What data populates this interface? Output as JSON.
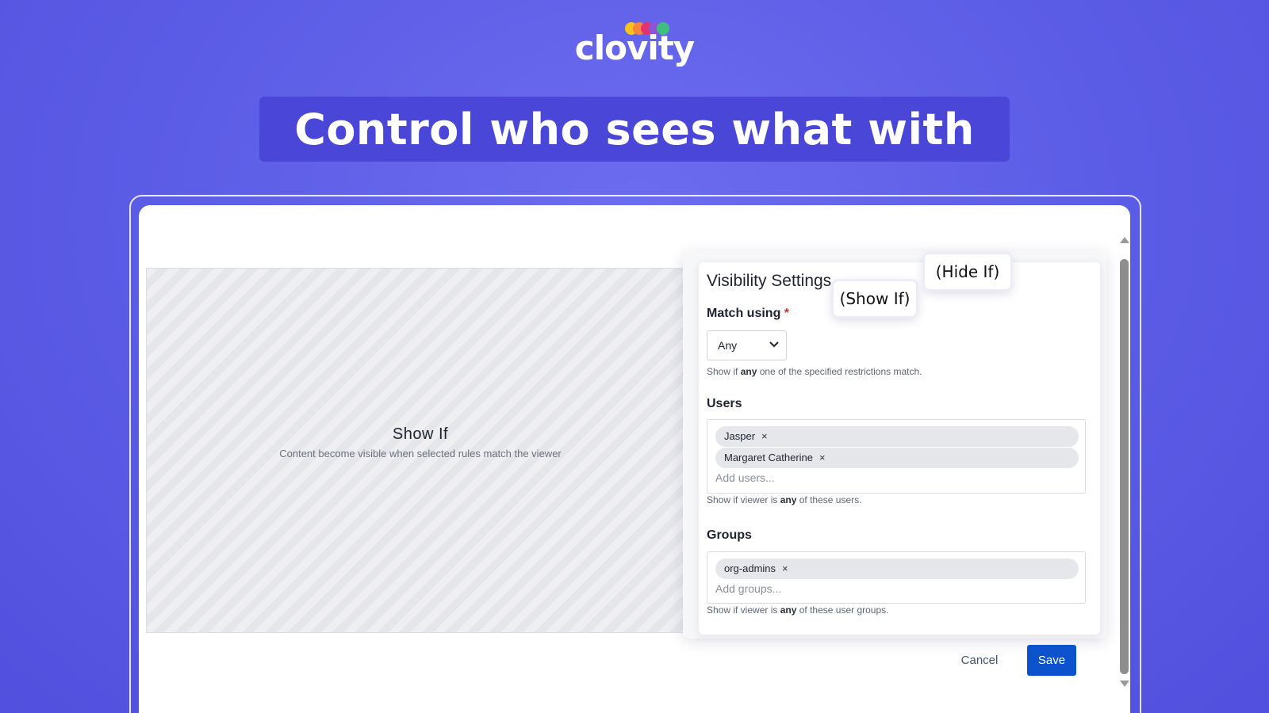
{
  "brand": {
    "name": "clovity",
    "dot_colors": [
      "#f7c21b",
      "#f5863a",
      "#e3336e",
      "#8f53d9",
      "#3fbf7f"
    ]
  },
  "headline": "Control who sees what with",
  "preview": {
    "title": "Show If",
    "description": "Content become visible when selected rules match the viewer"
  },
  "callouts": {
    "show_if": "(Show If)",
    "hide_if": "(Hide If)"
  },
  "panel": {
    "title": "Visibility Settings",
    "match": {
      "label": "Match using",
      "required_mark": "*",
      "selected": "Any",
      "help_prefix": "Show if",
      "help_bold": "any",
      "help_suffix": "one of the specified restrictions match."
    },
    "users": {
      "label": "Users",
      "chips": [
        "Jasper",
        "Margaret Catherine"
      ],
      "placeholder": "Add users...",
      "help_prefix": "Show if viewer is",
      "help_bold": "any",
      "help_suffix": "of these users."
    },
    "groups": {
      "label": "Groups",
      "chips": [
        "org-admins"
      ],
      "placeholder": "Add groups...",
      "help_prefix": "Show if viewer is",
      "help_bold": "any",
      "help_suffix": "of these user groups."
    }
  },
  "actions": {
    "cancel": "Cancel",
    "save": "Save"
  },
  "remove_glyph": "×"
}
